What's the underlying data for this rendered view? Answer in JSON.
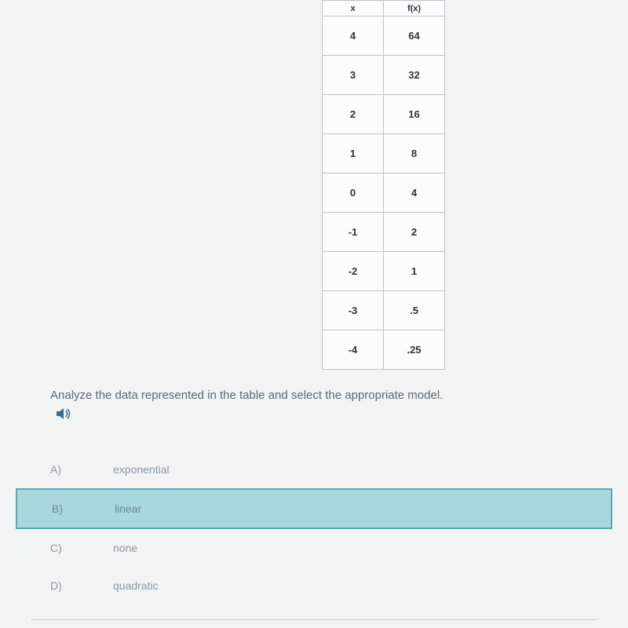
{
  "chart_data": {
    "type": "table",
    "columns": [
      "x",
      "f(x)"
    ],
    "rows": [
      [
        "4",
        "64"
      ],
      [
        "3",
        "32"
      ],
      [
        "2",
        "16"
      ],
      [
        "1",
        "8"
      ],
      [
        "0",
        "4"
      ],
      [
        "-1",
        "2"
      ],
      [
        "-2",
        "1"
      ],
      [
        "-3",
        ".5"
      ],
      [
        "-4",
        ".25"
      ]
    ]
  },
  "table": {
    "header": {
      "col1": "x",
      "col2": "f(x)"
    },
    "rows": [
      {
        "col1": "4",
        "col2": "64"
      },
      {
        "col1": "3",
        "col2": "32"
      },
      {
        "col1": "2",
        "col2": "16"
      },
      {
        "col1": "1",
        "col2": "8"
      },
      {
        "col1": "0",
        "col2": "4"
      },
      {
        "col1": "-1",
        "col2": "2"
      },
      {
        "col1": "-2",
        "col2": "1"
      },
      {
        "col1": "-3",
        "col2": ".5"
      },
      {
        "col1": "-4",
        "col2": ".25"
      }
    ]
  },
  "question": {
    "text": "Analyze the data represented in the table and select the appropriate model."
  },
  "options": [
    {
      "letter": "A)",
      "text": "exponential",
      "selected": false
    },
    {
      "letter": "B)",
      "text": "linear",
      "selected": true
    },
    {
      "letter": "C)",
      "text": "none",
      "selected": false
    },
    {
      "letter": "D)",
      "text": "quadratic",
      "selected": false
    }
  ]
}
